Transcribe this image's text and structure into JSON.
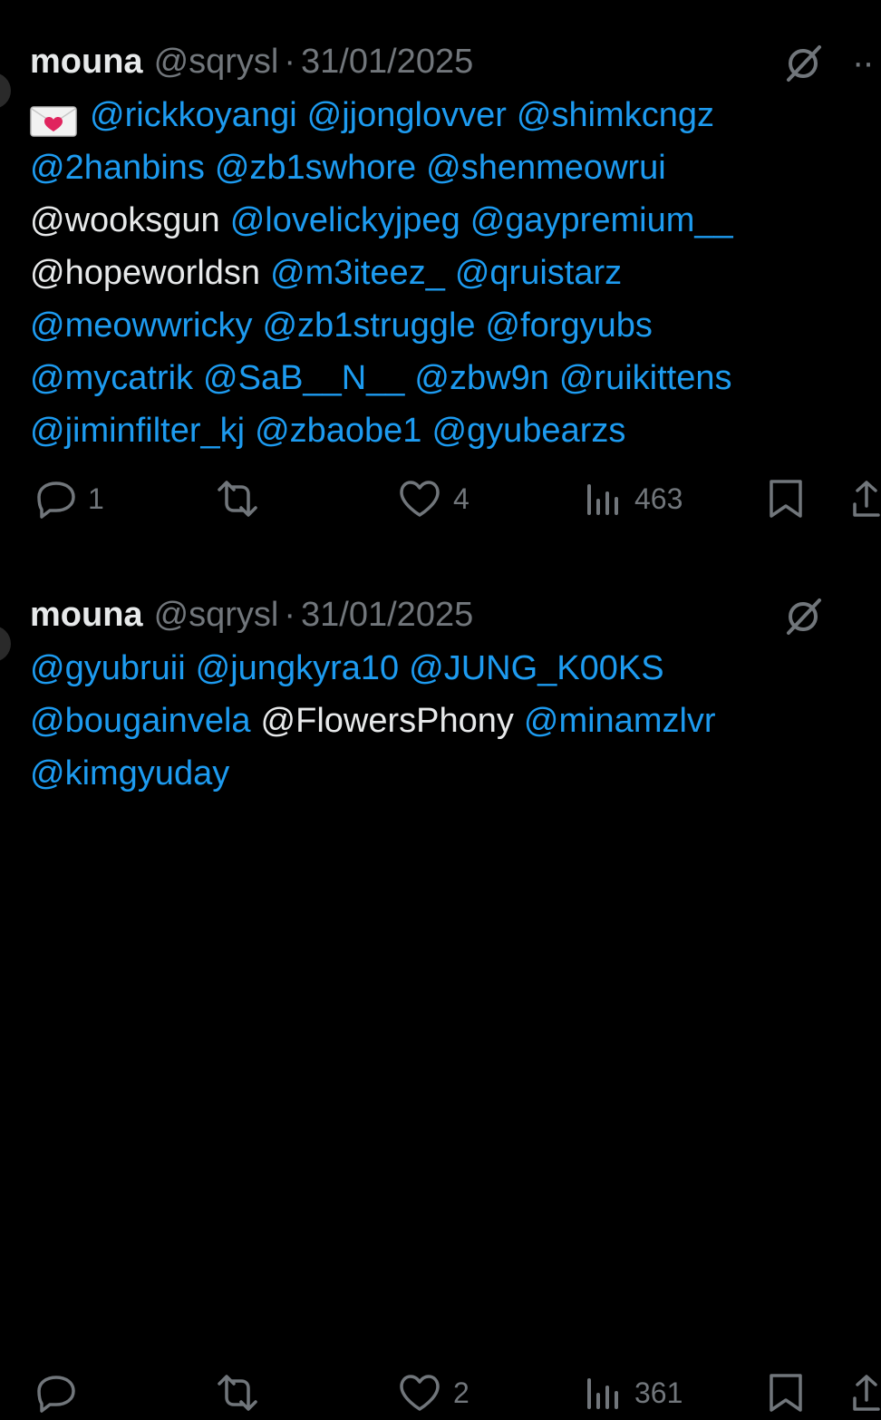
{
  "tweets": [
    {
      "name": "mouna",
      "handle": "@sqrysl",
      "separator": "·",
      "date": "31/01/2025",
      "icon": "envelope-heart-icon",
      "lines": [
        [
          {
            "text": "@rickkoyangi",
            "mention": true
          },
          {
            "text": "@jjonglovver",
            "mention": true
          },
          {
            "text": "@shimkcngz",
            "mention": true
          }
        ],
        [
          {
            "text": "@2hanbins",
            "mention": true
          },
          {
            "text": "@zb1swhore",
            "mention": true
          },
          {
            "text": "@shenmeowrui",
            "mention": true
          }
        ],
        [
          {
            "text": "@wooksgun",
            "mention": false
          },
          {
            "text": "@lovelickyjpeg",
            "mention": true
          },
          {
            "text": "@gaypremium__",
            "mention": true
          }
        ],
        [
          {
            "text": "@hopeworldsn",
            "mention": false
          },
          {
            "text": "@m3iteez_",
            "mention": true
          },
          {
            "text": "@qruistarz",
            "mention": true
          }
        ],
        [
          {
            "text": "@meowwricky",
            "mention": true
          },
          {
            "text": "@zb1struggle",
            "mention": true
          },
          {
            "text": "@forgyubs",
            "mention": true
          }
        ],
        [
          {
            "text": "@mycatrik",
            "mention": true
          },
          {
            "text": "@SaB__N__",
            "mention": true
          },
          {
            "text": "@zbw9n",
            "mention": true
          },
          {
            "text": "@ruikittens",
            "mention": true
          }
        ],
        [
          {
            "text": "@jiminfilter_kj",
            "mention": true
          },
          {
            "text": "@zbaobe1",
            "mention": true
          },
          {
            "text": "@gyubearzs",
            "mention": true
          }
        ]
      ],
      "stats": {
        "replies": "1",
        "reposts": "",
        "likes": "4",
        "views": "463"
      }
    },
    {
      "name": "mouna",
      "handle": "@sqrysl",
      "separator": "·",
      "date": "31/01/2025",
      "lines": [
        [
          {
            "text": "@gyubruii",
            "mention": true
          },
          {
            "text": "@jungkyra10",
            "mention": true
          },
          {
            "text": "@JUNG_K00KS",
            "mention": true
          }
        ],
        [
          {
            "text": "@bougainvela",
            "mention": true
          },
          {
            "text": "@FlowersPhony",
            "mention": false
          },
          {
            "text": "@minamzlvr",
            "mention": true
          }
        ],
        [
          {
            "text": "@kimgyuday",
            "mention": true
          }
        ]
      ],
      "stats": {
        "replies": "",
        "reposts": "",
        "likes": "2",
        "views": "361"
      }
    }
  ],
  "colors": {
    "background": "#000000",
    "text": "#e7e9ea",
    "mention": "#1d9bf0",
    "muted": "#71767b"
  }
}
